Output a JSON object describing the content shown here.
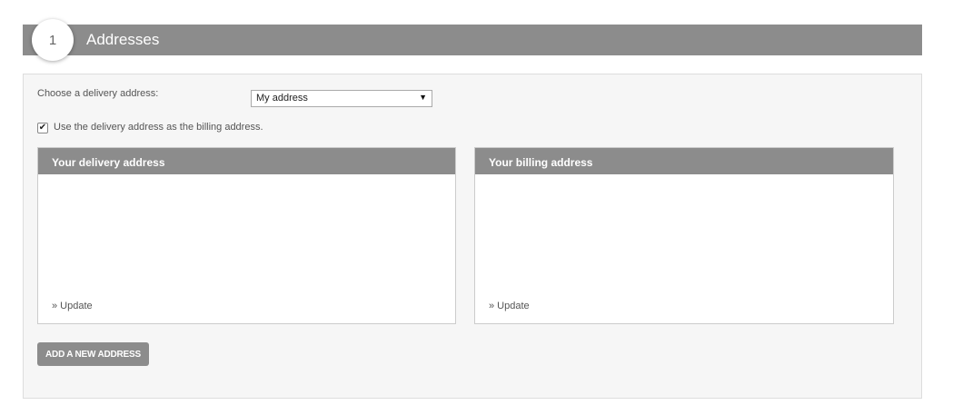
{
  "step": {
    "number": "1",
    "title": "Addresses"
  },
  "delivery_select": {
    "label": "Choose a delivery address:",
    "selected": "My address",
    "arrow": "▼"
  },
  "billing_checkbox": {
    "checked_mark": "✔",
    "label": "Use the delivery address as the billing address."
  },
  "delivery_box": {
    "title": "Your delivery address",
    "update_link": "» Update"
  },
  "billing_box": {
    "title": "Your billing address",
    "update_link": "» Update"
  },
  "add_address_button": "ADD A NEW ADDRESS",
  "colors": {
    "header_gray": "#8c8c8c",
    "panel_bg": "#f6f6f6"
  }
}
